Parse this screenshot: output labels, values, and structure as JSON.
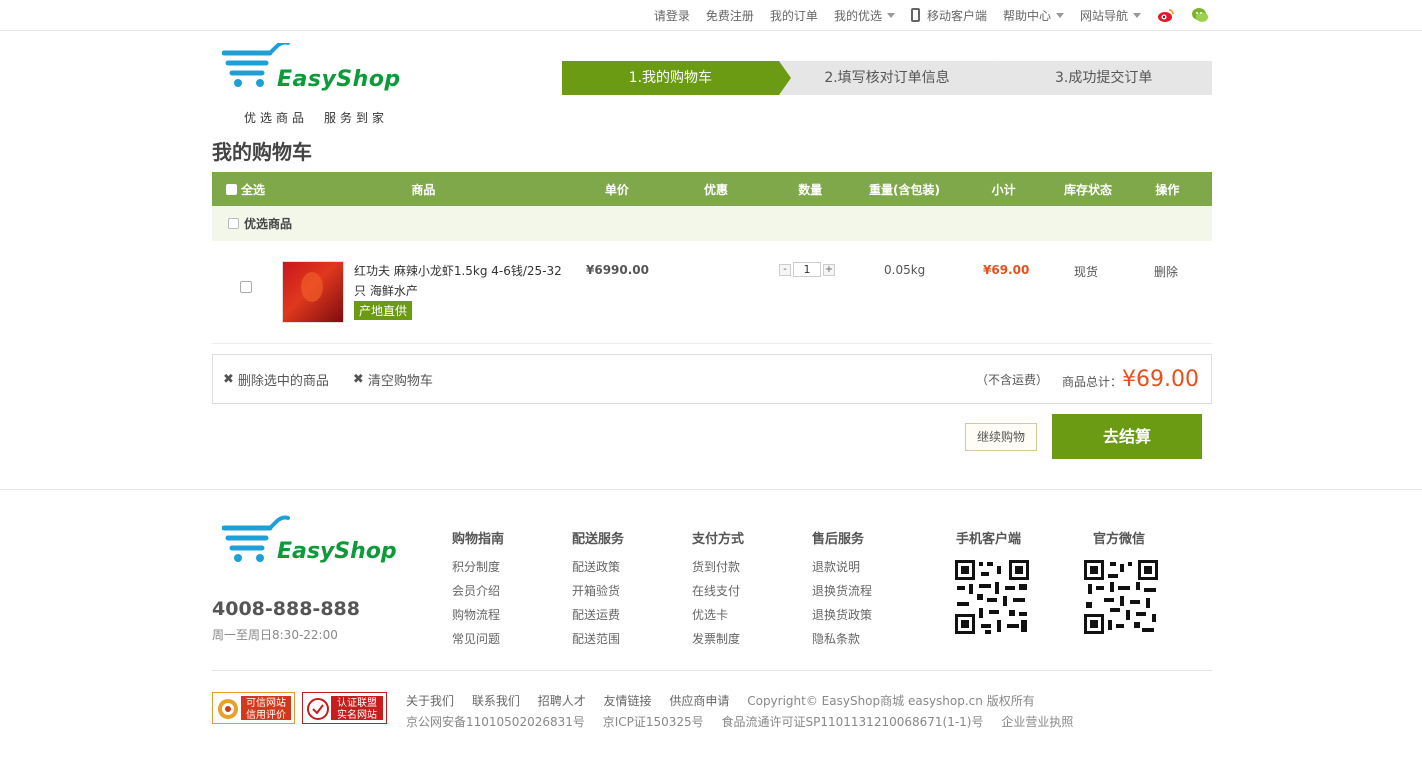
{
  "topnav": {
    "login": "请登录",
    "register": "免费注册",
    "orders": "我的订单",
    "my_pick": "我的优选",
    "mobile": "移动客户端",
    "help": "帮助中心",
    "site_nav": "网站导航"
  },
  "brand": {
    "name": "EasyShop",
    "slogan": "优选商品　服务到家"
  },
  "steps": [
    "1.我的购物车",
    "2.填写核对订单信息",
    "3.成功提交订单"
  ],
  "page_title": "我的购物车",
  "cart_head": {
    "select_all": "全选",
    "goods": "商品",
    "price": "单价",
    "discount": "优惠",
    "quantity": "数量",
    "weight": "重量(含包装)",
    "subtotal": "小计",
    "stock": "库存状态",
    "op": "操作"
  },
  "shop_group": "优选商品",
  "item": {
    "name": "红功夫 麻辣小龙虾1.5kg 4-6钱/25-32只 海鲜水产",
    "tag": "产地直供",
    "price": "¥6990.00",
    "quantity": "1",
    "weight": "0.05kg",
    "subtotal": "¥69.00",
    "stock": "现货",
    "delete": "删除"
  },
  "summary": {
    "delete_selected": "删除选中的商品",
    "clear_cart": "清空购物车",
    "no_shipping": "（不含运费）",
    "total_label": "商品总计：",
    "total": "¥69.00"
  },
  "actions": {
    "continue": "继续购物",
    "checkout": "去结算"
  },
  "footer": {
    "hotline": "4008-888-888",
    "hours": "周一至周日8:30-22:00",
    "cols": [
      {
        "title": "购物指南",
        "links": [
          "积分制度",
          "会员介绍",
          "购物流程",
          "常见问题"
        ]
      },
      {
        "title": "配送服务",
        "links": [
          "配送政策",
          "开箱验货",
          "配送运费",
          "配送范围"
        ]
      },
      {
        "title": "支付方式",
        "links": [
          "货到付款",
          "在线支付",
          "优选卡",
          "发票制度"
        ]
      },
      {
        "title": "售后服务",
        "links": [
          "退款说明",
          "退换货流程",
          "退换货政策",
          "隐私条款"
        ]
      }
    ],
    "qr_mobile": "手机客户端",
    "qr_wechat": "官方微信",
    "badge1": "可信网站\n信用评价",
    "badge2": "认证联盟\n实名网站",
    "links": [
      "关于我们",
      "联系我们",
      "招聘人才",
      "友情链接",
      "供应商申请"
    ],
    "copyright": "Copyright© EasyShop商城 easyshop.cn 版权所有",
    "icp": [
      "京公网安备11010502026831号",
      "京ICP证150325号",
      "食品流通许可证SP1101131210068671(1-1)号",
      "企业营业执照"
    ]
  },
  "colors": {
    "accent": "#6a9b13",
    "table_head": "#7fa84a",
    "price_red": "#e8501b"
  }
}
